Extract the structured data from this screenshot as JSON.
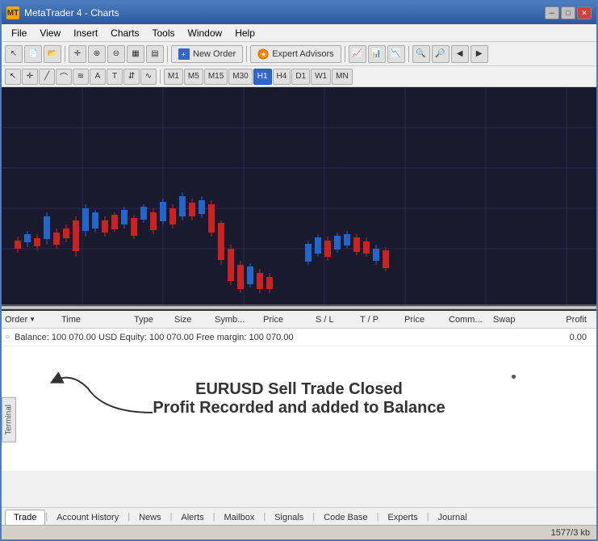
{
  "titleBar": {
    "title": "MetaTrader 4 - Charts",
    "icon": "MT",
    "minimizeBtn": "─",
    "maximizeBtn": "□",
    "closeBtn": "✕"
  },
  "menuBar": {
    "items": [
      "File",
      "View",
      "Insert",
      "Charts",
      "Tools",
      "Window",
      "Help"
    ]
  },
  "toolbar": {
    "newOrderBtn": "New Order",
    "expertAdvisorsBtn": "Expert Advisors",
    "timeframes": [
      "M1",
      "M5",
      "M15",
      "M30",
      "H1",
      "H4",
      "D1",
      "W1",
      "MN"
    ],
    "activeTimeframe": "H1"
  },
  "terminal": {
    "columns": [
      "Order",
      "Time",
      "Type",
      "Size",
      "Symb...",
      "Price",
      "S / L",
      "T / P",
      "Price",
      "Comm...",
      "Swap",
      "Profit"
    ],
    "balanceRow": {
      "text": "Balance: 100 070.00 USD    Equity: 100 070.00    Free margin: 100 070.00",
      "profit": "0.00"
    }
  },
  "annotation": {
    "line1": "EURUSD Sell Trade Closed",
    "line2": "Profit Recorded and added to Balance"
  },
  "tabs": [
    {
      "label": "Trade",
      "active": true
    },
    {
      "label": "Account History",
      "active": false
    },
    {
      "label": "News",
      "active": false
    },
    {
      "label": "Alerts",
      "active": false
    },
    {
      "label": "Mailbox",
      "active": false
    },
    {
      "label": "Signals",
      "active": false
    },
    {
      "label": "Code Base",
      "active": false
    },
    {
      "label": "Experts",
      "active": false
    },
    {
      "label": "Journal",
      "active": false
    }
  ],
  "statusBar": {
    "text": "1577/3 kb"
  },
  "sideLabel": "Terminal"
}
